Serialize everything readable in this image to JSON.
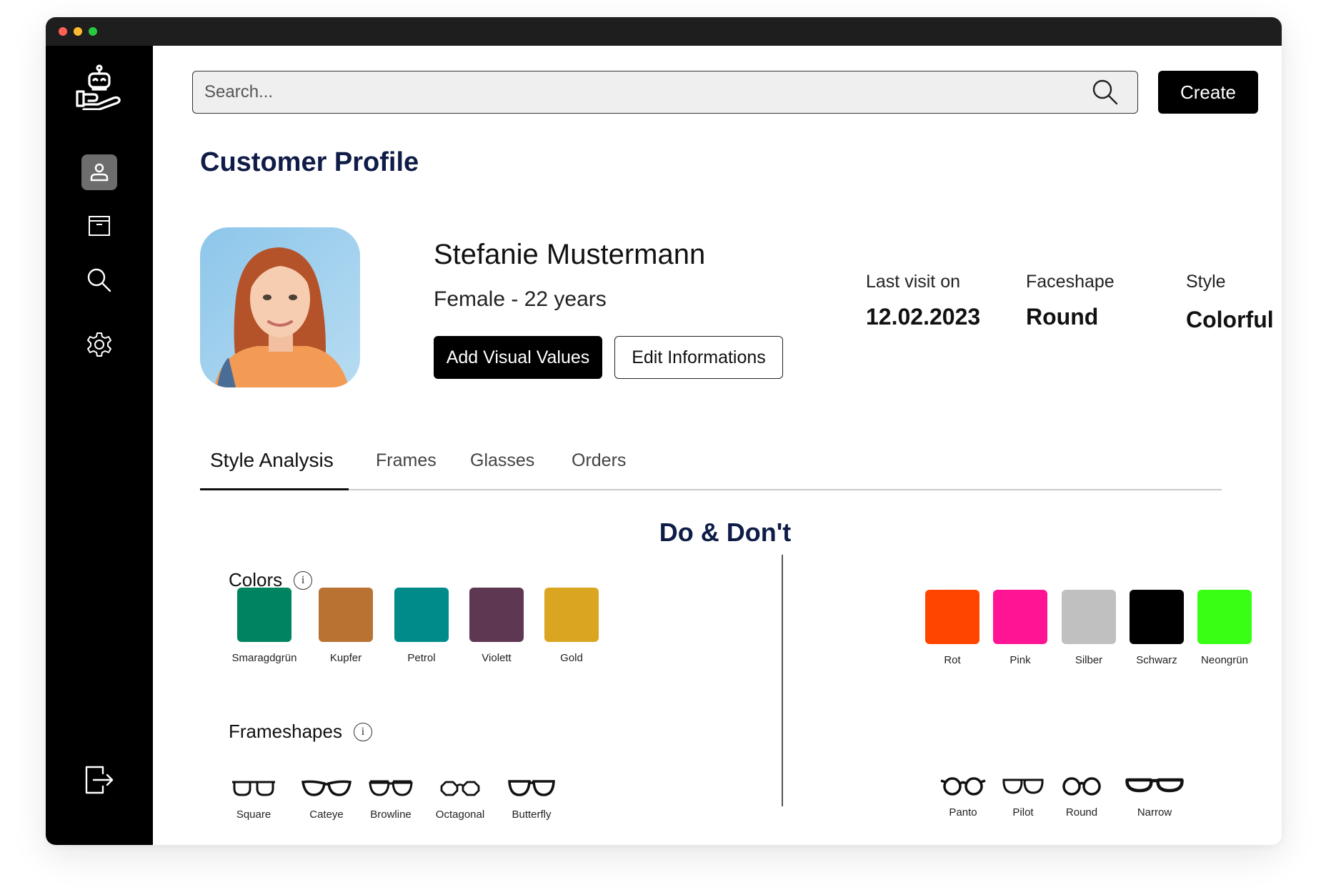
{
  "sidebar": {
    "items": [
      {
        "icon": "customer-profile-icon",
        "active": true
      },
      {
        "icon": "archive-icon",
        "active": false
      },
      {
        "icon": "search-icon",
        "active": false
      },
      {
        "icon": "settings-icon",
        "active": false
      }
    ],
    "logout_icon": "logout-icon"
  },
  "search": {
    "placeholder": "Search..."
  },
  "header": {
    "create_label": "Create"
  },
  "page": {
    "title": "Customer Profile"
  },
  "customer": {
    "name": "Stefanie Mustermann",
    "meta": "Female - 22 years",
    "add_visual_label": "Add Visual Values",
    "edit_label": "Edit Informations",
    "info": [
      {
        "label": "Last visit on",
        "value": "12.02.2023"
      },
      {
        "label": "Faceshape",
        "value": "Round"
      },
      {
        "label": "Style",
        "value": "Colorful"
      }
    ]
  },
  "tabs": [
    {
      "label": "Style Analysis",
      "active": true
    },
    {
      "label": "Frames",
      "active": false
    },
    {
      "label": "Glasses",
      "active": false
    },
    {
      "label": "Orders",
      "active": false
    }
  ],
  "analysis": {
    "title": "Do & Don't",
    "colors_heading": "Colors",
    "frameshapes_heading": "Frameshapes",
    "info_glyph": "i",
    "do_colors": [
      {
        "name": "Smaragdgrün",
        "hex": "#00835f"
      },
      {
        "name": "Kupfer",
        "hex": "#b87333"
      },
      {
        "name": "Petrol",
        "hex": "#008b8b"
      },
      {
        "name": "Violett",
        "hex": "#5e3853"
      },
      {
        "name": "Gold",
        "hex": "#daa520"
      }
    ],
    "dont_colors": [
      {
        "name": "Rot",
        "hex": "#ff4500"
      },
      {
        "name": "Pink",
        "hex": "#ff1493"
      },
      {
        "name": "Silber",
        "hex": "#c0c0c0"
      },
      {
        "name": "Schwarz",
        "hex": "#000000"
      },
      {
        "name": "Neongrün",
        "hex": "#39ff14"
      }
    ],
    "do_frames": [
      "Square",
      "Cateye",
      "Browline",
      "Octagonal",
      "Butterfly"
    ],
    "dont_frames": [
      "Panto",
      "Pilot",
      "Round",
      "Narrow"
    ]
  }
}
